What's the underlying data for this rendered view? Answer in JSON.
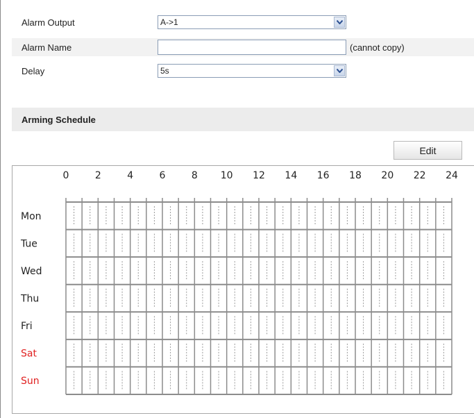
{
  "fields": {
    "alarm_output": {
      "label": "Alarm Output",
      "value": "A->1"
    },
    "alarm_name": {
      "label": "Alarm Name",
      "value": "",
      "hint": "(cannot copy)"
    },
    "delay": {
      "label": "Delay",
      "value": "5s"
    }
  },
  "arming_schedule": {
    "title": "Arming Schedule",
    "edit_label": "Edit",
    "hours": [
      "0",
      "2",
      "4",
      "6",
      "8",
      "10",
      "12",
      "14",
      "16",
      "18",
      "20",
      "22",
      "24"
    ],
    "days": [
      {
        "label": "Mon",
        "weekend": false
      },
      {
        "label": "Tue",
        "weekend": false
      },
      {
        "label": "Wed",
        "weekend": false
      },
      {
        "label": "Thu",
        "weekend": false
      },
      {
        "label": "Fri",
        "weekend": false
      },
      {
        "label": "Sat",
        "weekend": true
      },
      {
        "label": "Sun",
        "weekend": true
      }
    ]
  },
  "colors": {
    "weekday_text": "#222222",
    "weekend_text": "#e02020",
    "grid_major": "#8c8c8c",
    "grid_minor": "#9a9a9a"
  },
  "icons": {
    "dropdown": "chevron-down-icon"
  }
}
